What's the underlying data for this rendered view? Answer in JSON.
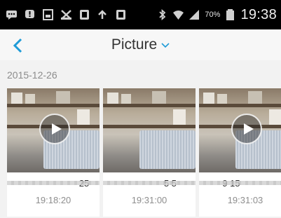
{
  "status_bar": {
    "left_icons": [
      "message-icon",
      "notification-icon",
      "gallery-icon",
      "tools-icon",
      "app-icon",
      "sync-icon",
      "app2-icon"
    ],
    "right_icons": [
      "bluetooth-icon",
      "wifi-icon",
      "signal-icon"
    ],
    "battery": "70%",
    "time": "19:38"
  },
  "header": {
    "title": "Picture"
  },
  "section": {
    "date": "2015-12-26",
    "items": [
      {
        "caption": "25",
        "time": "19:18:20"
      },
      {
        "caption": "5 5",
        "time": "19:31:00"
      },
      {
        "caption": "9 15",
        "time": "19:31:03"
      }
    ]
  },
  "colors": {
    "accent": "#1e9bd7",
    "status_bar_bg": "#000000",
    "header_bg": "#f7f7f7",
    "section_bg": "#f2f2f2"
  }
}
